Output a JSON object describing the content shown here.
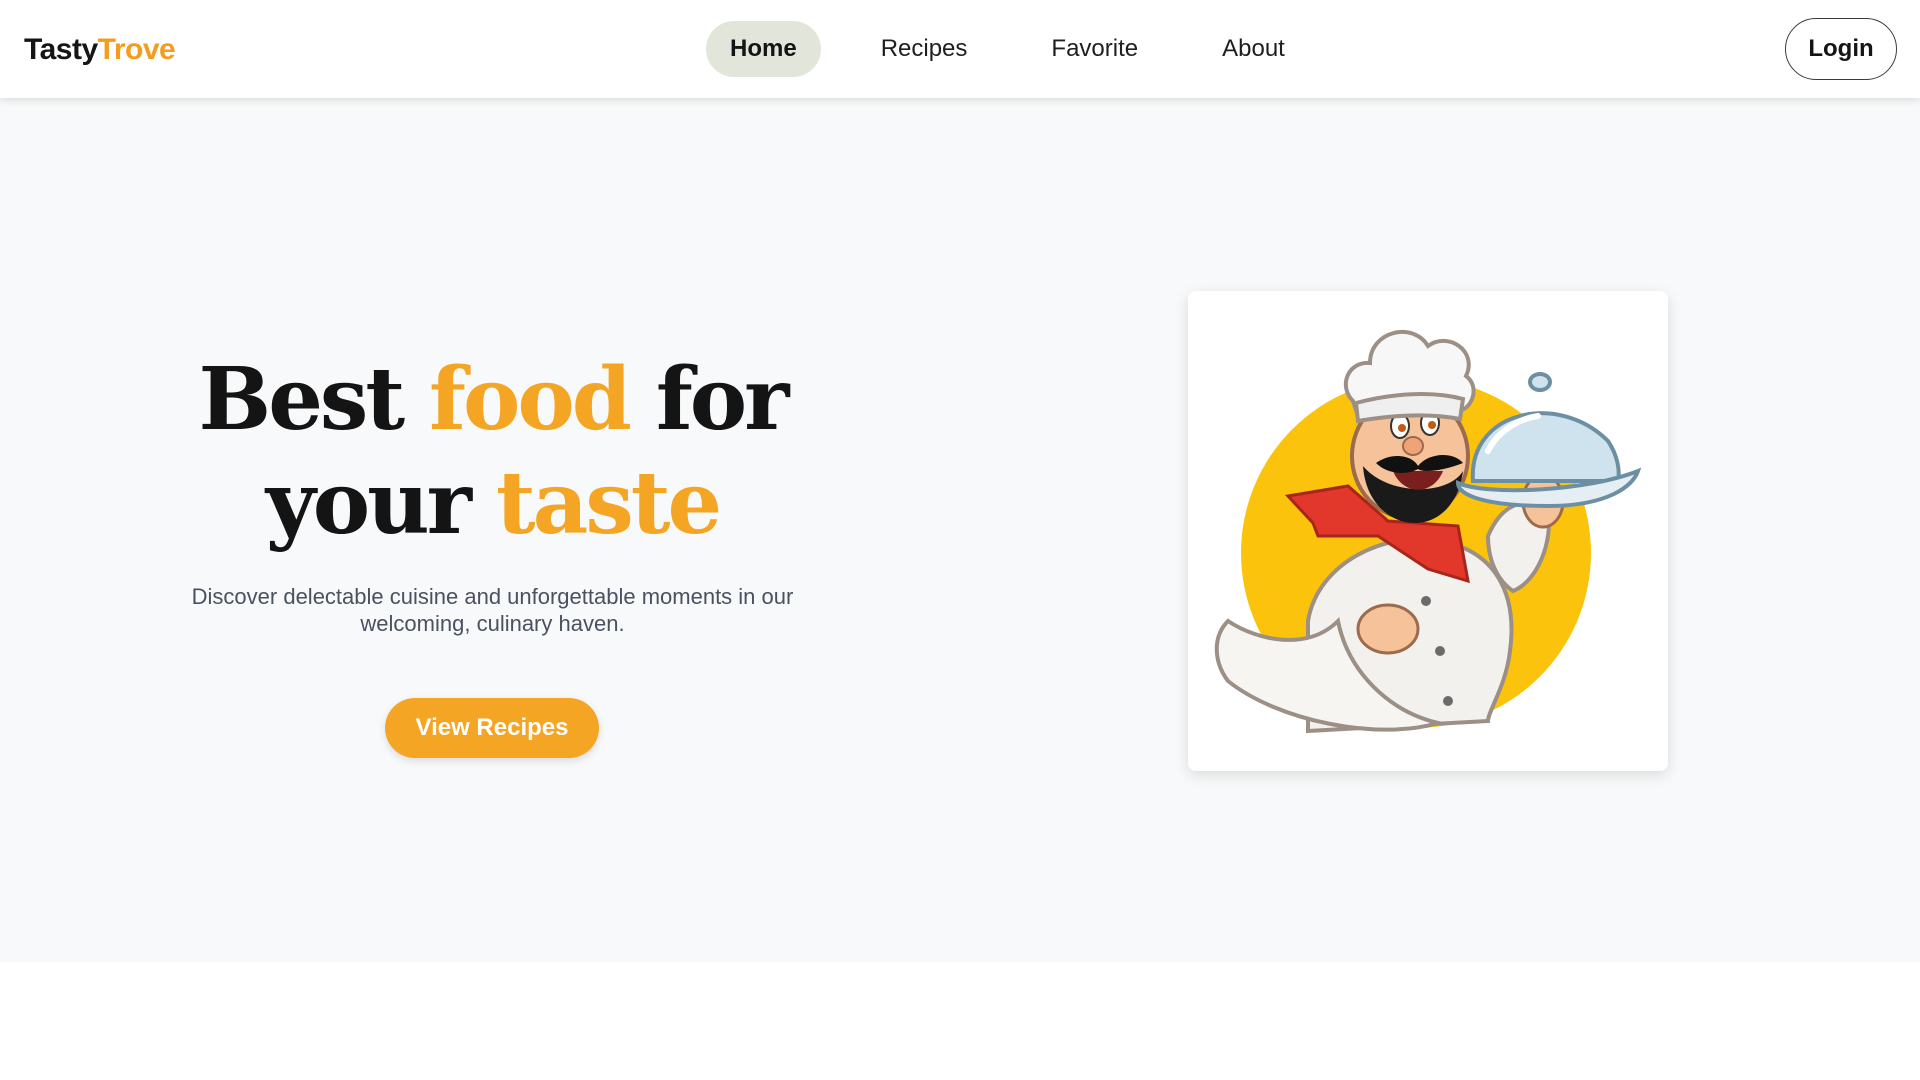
{
  "header": {
    "logo": {
      "part1": "Tasty",
      "part2": "Trove"
    },
    "nav": [
      {
        "label": "Home",
        "active": true
      },
      {
        "label": "Recipes",
        "active": false
      },
      {
        "label": "Favorite",
        "active": false
      },
      {
        "label": "About",
        "active": false
      }
    ],
    "login_label": "Login"
  },
  "hero": {
    "title": {
      "line1_a": "Best ",
      "line1_accent": "food",
      "line1_b": " for",
      "line2_a": "your ",
      "line2_accent": "taste"
    },
    "description": "Discover delectable cuisine and unforgettable moments in our welcoming, culinary haven.",
    "cta_label": "View Recipes",
    "illustration": "chef-mascot-illustration"
  },
  "colors": {
    "accent": "#f5a524",
    "nav_active_bg": "#e2e6da",
    "hero_bg": "#f8f9fa",
    "text_dark": "#141414"
  }
}
